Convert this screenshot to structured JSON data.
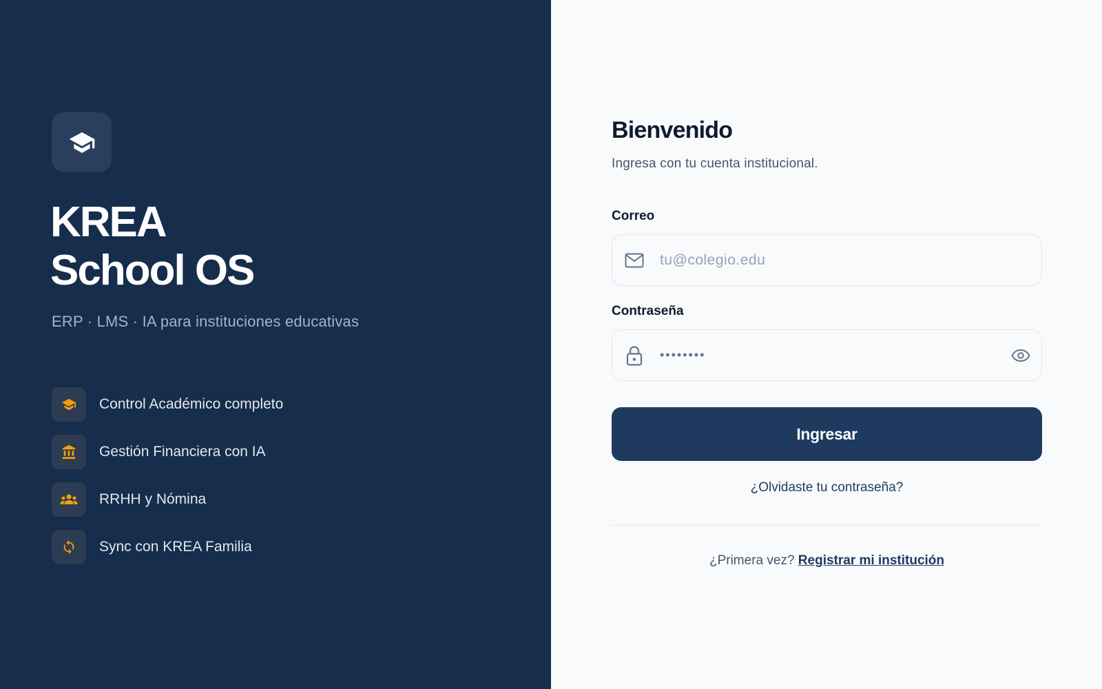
{
  "brand": {
    "line1": "KREA",
    "line2": "School OS",
    "tagline": "ERP · LMS · IA para instituciones educativas",
    "logo_icon": "graduation-cap-icon"
  },
  "features": [
    {
      "label": "Control Académico completo",
      "icon": "graduation-cap-icon"
    },
    {
      "label": "Gestión Financiera con IA",
      "icon": "bank-icon"
    },
    {
      "label": "RRHH y Nómina",
      "icon": "people-icon"
    },
    {
      "label": "Sync con KREA Familia",
      "icon": "sync-icon"
    }
  ],
  "login": {
    "title": "Bienvenido",
    "subtitle": "Ingresa con tu cuenta institucional.",
    "email_label": "Correo",
    "email_placeholder": "tu@colegio.edu",
    "password_label": "Contraseña",
    "password_value": "••••••••",
    "submit_label": "Ingresar",
    "forgot_label": "¿Olvidaste tu contraseña?",
    "first_time_text": "¿Primera vez?",
    "register_label": "Registrar mi institución"
  },
  "colors": {
    "left_bg": "#162d4b",
    "accent": "#f59e0b",
    "primary": "#1e3a5f"
  }
}
